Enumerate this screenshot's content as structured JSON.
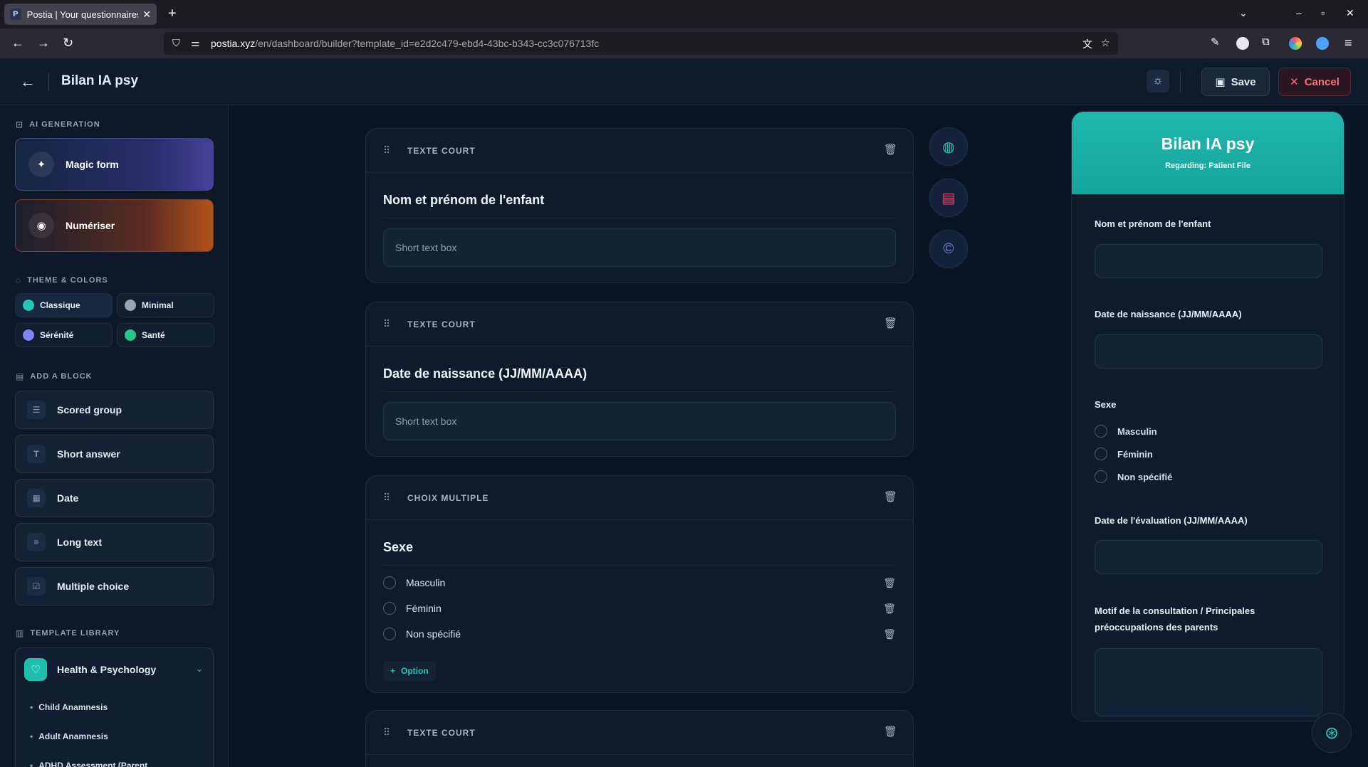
{
  "browser": {
    "tab_title": "Postia | Your questionnaires",
    "tab_favicon": "P",
    "url_domain": "postia.xyz",
    "url_path": "/en/dashboard/builder?template_id=e2d2c479-ebd4-43bc-b343-cc3c076713fc"
  },
  "header": {
    "title": "Bilan IA psy",
    "save_label": "Save",
    "cancel_label": "Cancel"
  },
  "sidebar": {
    "ai_label": "AI GENERATION",
    "magic_label": "Magic form",
    "scan_label": "Numériser",
    "theme_label": "THEME & COLORS",
    "themes": [
      {
        "name": "Classique",
        "color": "#20c9b5"
      },
      {
        "name": "Minimal",
        "color": "#9aa4b4"
      },
      {
        "name": "Sérénité",
        "color": "#7d86f0"
      },
      {
        "name": "Santé",
        "color": "#22c98a"
      }
    ],
    "block_label": "ADD A BLOCK",
    "blocks": [
      "Scored group",
      "Short answer",
      "Date",
      "Long text",
      "Multiple choice"
    ],
    "library_label": "TEMPLATE LIBRARY",
    "library_category": "Health & Psychology",
    "library_items": [
      "Child Anamnesis",
      "Adult Anamnesis",
      "ADHD Assessment (Parent"
    ]
  },
  "builder": {
    "questions": [
      {
        "type": "TEXTE COURT",
        "title": "Nom et prénom de l'enfant",
        "placeholder": "Short text box"
      },
      {
        "type": "TEXTE COURT",
        "title": "Date de naissance (JJ/MM/AAAA)",
        "placeholder": "Short text box"
      },
      {
        "type": "CHOIX MULTIPLE",
        "title": "Sexe",
        "options": [
          "Masculin",
          "Féminin",
          "Non spécifié"
        ],
        "add_option": "Option"
      },
      {
        "type": "TEXTE COURT"
      }
    ]
  },
  "preview": {
    "title": "Bilan IA psy",
    "subtitle": "Regarding: Patient File",
    "fields": [
      "Nom et prénom de l'enfant",
      "Date de naissance (JJ/MM/AAAA)",
      "Sexe",
      "Date de l'évaluation (JJ/MM/AAAA)",
      "Motif de la consultation / Principales préoccupations des parents"
    ],
    "sexe_options": [
      "Masculin",
      "Féminin",
      "Non spécifié"
    ]
  },
  "colors": {
    "accent": "#20c9b5",
    "cancel": "#ff6f7d",
    "preview_header": "#1aada6"
  }
}
